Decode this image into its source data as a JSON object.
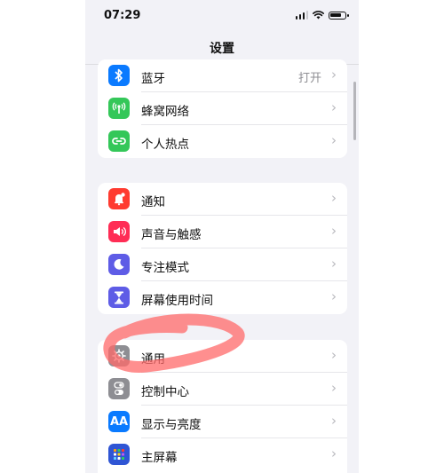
{
  "status_bar": {
    "time": "07:29"
  },
  "nav": {
    "title": "设置"
  },
  "groups": [
    {
      "items": [
        {
          "label": "蓝牙",
          "value": "打开",
          "icon": "bluetooth-icon",
          "color": "#0a7aff"
        },
        {
          "label": "蜂窝网络",
          "icon": "cellular-icon",
          "color": "#34c759"
        },
        {
          "label": "个人热点",
          "icon": "hotspot-icon",
          "color": "#34c759"
        }
      ]
    },
    {
      "items": [
        {
          "label": "通知",
          "icon": "notification-icon",
          "color": "#ff3b30"
        },
        {
          "label": "声音与触感",
          "icon": "sound-icon",
          "color": "#ff2d55"
        },
        {
          "label": "专注模式",
          "icon": "moon-icon",
          "color": "#5e5ce6"
        },
        {
          "label": "屏幕使用时间",
          "icon": "hourglass-icon",
          "color": "#5e5ce6"
        }
      ]
    },
    {
      "items": [
        {
          "label": "通用",
          "icon": "gear-icon",
          "color": "#8e8e93"
        },
        {
          "label": "控制中心",
          "icon": "toggles-icon",
          "color": "#8e8e93"
        },
        {
          "label": "显示与亮度",
          "icon": "text-size-icon",
          "icon_text": "AA",
          "color": "#0a7aff"
        },
        {
          "label": "主屏幕",
          "icon": "home-screen-icon",
          "color": "#2f55d4"
        }
      ]
    }
  ],
  "annotation": {
    "color": "#ff6a6a"
  }
}
